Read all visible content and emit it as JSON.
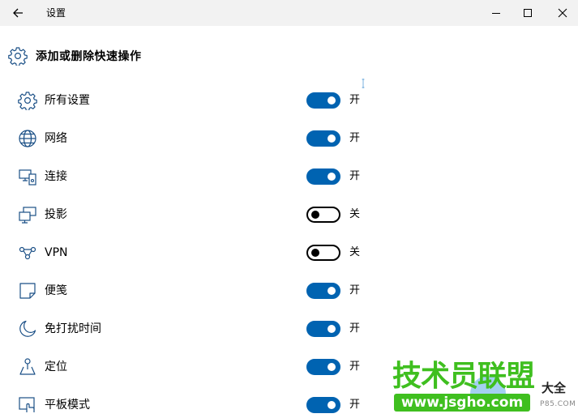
{
  "titlebar": {
    "title": "设置",
    "back_icon": "back-arrow-icon",
    "minimize_icon": "minimize-icon",
    "maximize_icon": "maximize-icon",
    "close_icon": "close-icon"
  },
  "section": {
    "title": "添加或删除快速操作",
    "icon": "gear-icon"
  },
  "items": [
    {
      "label": "所有设置",
      "icon": "gear-icon",
      "on": true,
      "state_text": "开"
    },
    {
      "label": "网络",
      "icon": "globe-icon",
      "on": true,
      "state_text": "开"
    },
    {
      "label": "连接",
      "icon": "connect-icon",
      "on": true,
      "state_text": "开"
    },
    {
      "label": "投影",
      "icon": "project-icon",
      "on": false,
      "state_text": "关"
    },
    {
      "label": "VPN",
      "icon": "vpn-icon",
      "on": false,
      "state_text": "关"
    },
    {
      "label": "便笺",
      "icon": "note-icon",
      "on": true,
      "state_text": "开"
    },
    {
      "label": "免打扰时间",
      "icon": "moon-icon",
      "on": true,
      "state_text": "开"
    },
    {
      "label": "定位",
      "icon": "location-icon",
      "on": true,
      "state_text": "开"
    },
    {
      "label": "平板模式",
      "icon": "tablet-mode-icon",
      "on": true,
      "state_text": "开"
    }
  ],
  "watermark": {
    "main_text": "技术员联盟",
    "url_text": "www.jsgho.com",
    "side_text": "大全",
    "small_text": "P85.COM"
  },
  "colors": {
    "accent": "#0063b1",
    "titlebar_bg": "#f2f2f2",
    "watermark_green": "#3fbf1f"
  }
}
